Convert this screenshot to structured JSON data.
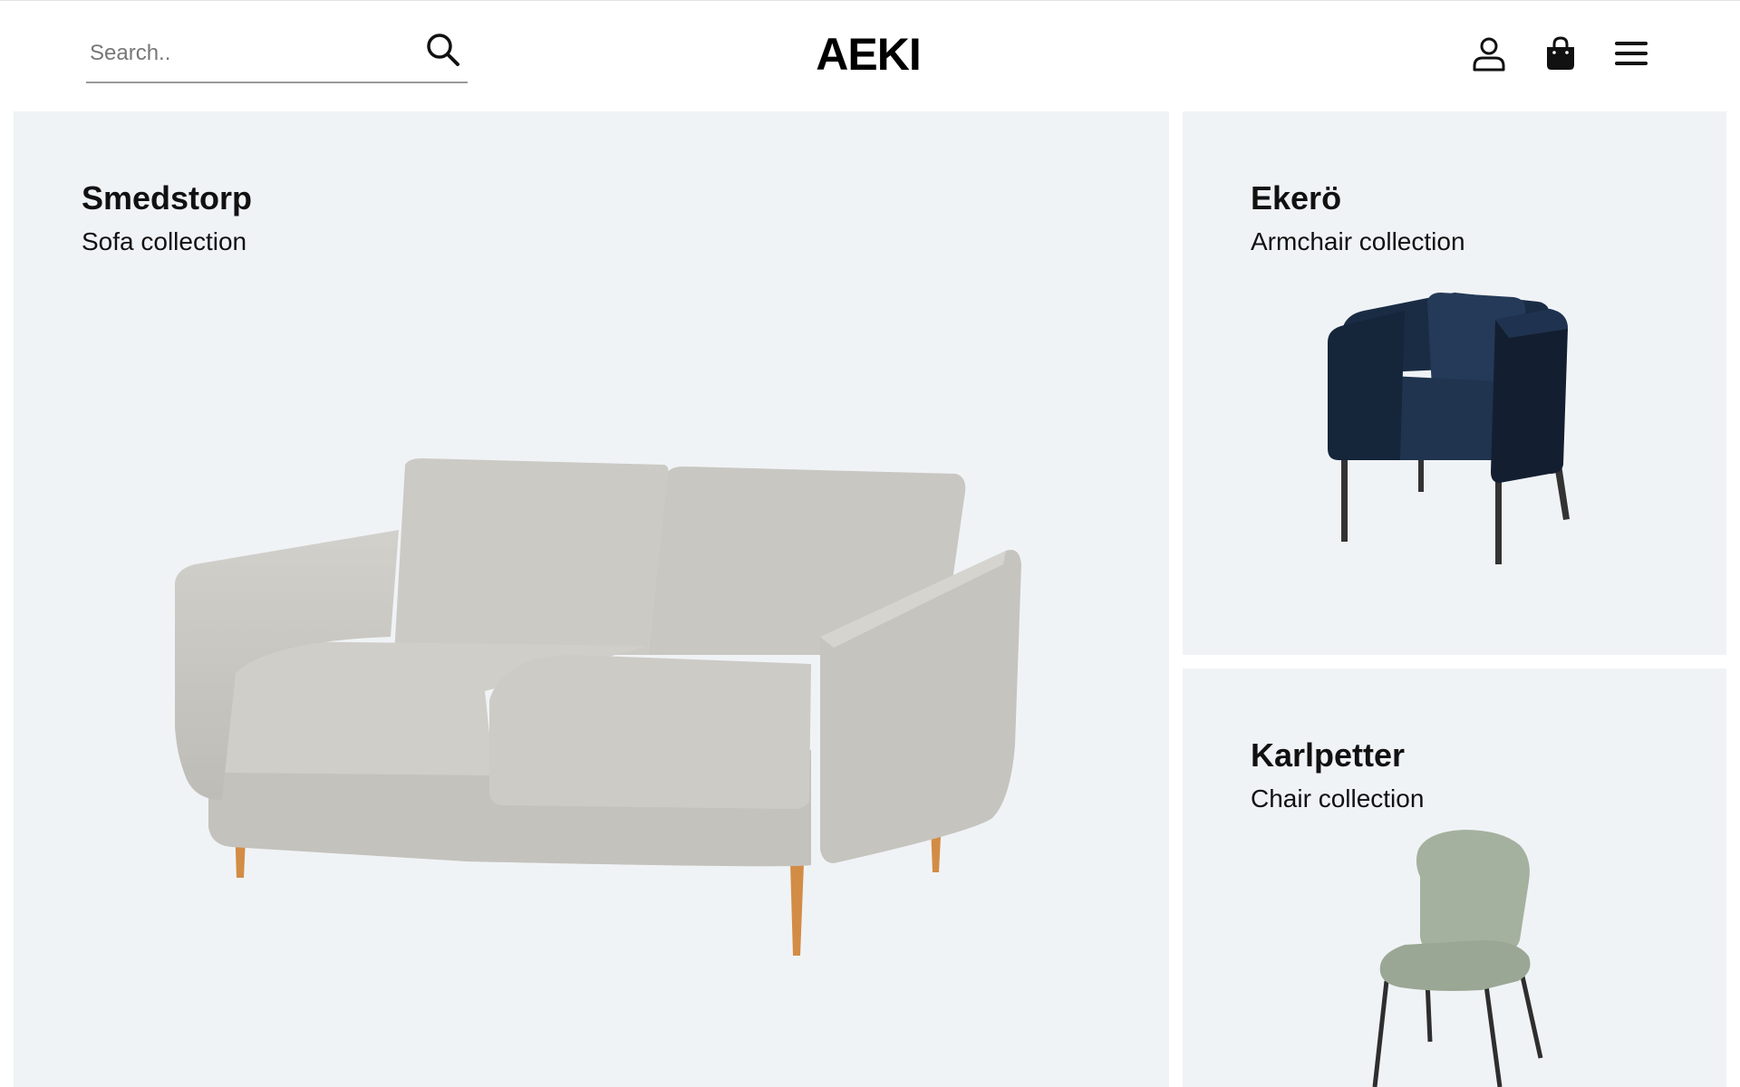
{
  "header": {
    "logo": "AEKI",
    "search": {
      "placeholder": "Search..",
      "value": "",
      "icon": "search-icon"
    },
    "icons": [
      "user-icon",
      "shopping-bag-icon",
      "menu-icon"
    ]
  },
  "collections": [
    {
      "name": "Smedstorp",
      "subtitle": "Sofa collection",
      "image": "sofa",
      "color": "#c9c7c2"
    },
    {
      "name": "Ekerö",
      "subtitle": "Armchair collection",
      "image": "armchair",
      "color": "#1c2e45"
    },
    {
      "name": "Karlpetter",
      "subtitle": "Chair collection",
      "image": "chair",
      "color": "#a7b3a1"
    }
  ],
  "colors": {
    "card_background": "#f0f3f6",
    "text": "#111111",
    "search_underline": "#9a9a9a"
  }
}
